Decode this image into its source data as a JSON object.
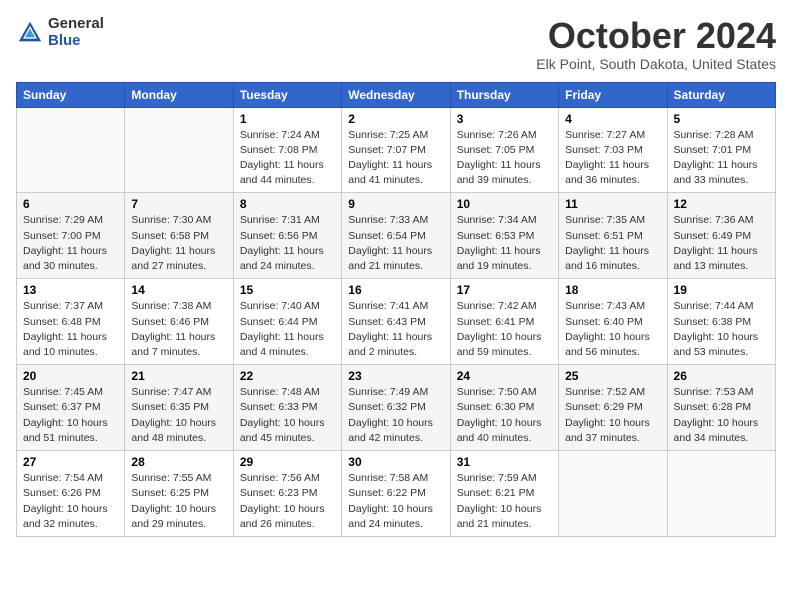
{
  "header": {
    "logo_general": "General",
    "logo_blue": "Blue",
    "title": "October 2024",
    "location": "Elk Point, South Dakota, United States"
  },
  "days_of_week": [
    "Sunday",
    "Monday",
    "Tuesday",
    "Wednesday",
    "Thursday",
    "Friday",
    "Saturday"
  ],
  "weeks": [
    [
      {
        "day": "",
        "content": ""
      },
      {
        "day": "",
        "content": ""
      },
      {
        "day": "1",
        "content": "Sunrise: 7:24 AM\nSunset: 7:08 PM\nDaylight: 11 hours and 44 minutes."
      },
      {
        "day": "2",
        "content": "Sunrise: 7:25 AM\nSunset: 7:07 PM\nDaylight: 11 hours and 41 minutes."
      },
      {
        "day": "3",
        "content": "Sunrise: 7:26 AM\nSunset: 7:05 PM\nDaylight: 11 hours and 39 minutes."
      },
      {
        "day": "4",
        "content": "Sunrise: 7:27 AM\nSunset: 7:03 PM\nDaylight: 11 hours and 36 minutes."
      },
      {
        "day": "5",
        "content": "Sunrise: 7:28 AM\nSunset: 7:01 PM\nDaylight: 11 hours and 33 minutes."
      }
    ],
    [
      {
        "day": "6",
        "content": "Sunrise: 7:29 AM\nSunset: 7:00 PM\nDaylight: 11 hours and 30 minutes."
      },
      {
        "day": "7",
        "content": "Sunrise: 7:30 AM\nSunset: 6:58 PM\nDaylight: 11 hours and 27 minutes."
      },
      {
        "day": "8",
        "content": "Sunrise: 7:31 AM\nSunset: 6:56 PM\nDaylight: 11 hours and 24 minutes."
      },
      {
        "day": "9",
        "content": "Sunrise: 7:33 AM\nSunset: 6:54 PM\nDaylight: 11 hours and 21 minutes."
      },
      {
        "day": "10",
        "content": "Sunrise: 7:34 AM\nSunset: 6:53 PM\nDaylight: 11 hours and 19 minutes."
      },
      {
        "day": "11",
        "content": "Sunrise: 7:35 AM\nSunset: 6:51 PM\nDaylight: 11 hours and 16 minutes."
      },
      {
        "day": "12",
        "content": "Sunrise: 7:36 AM\nSunset: 6:49 PM\nDaylight: 11 hours and 13 minutes."
      }
    ],
    [
      {
        "day": "13",
        "content": "Sunrise: 7:37 AM\nSunset: 6:48 PM\nDaylight: 11 hours and 10 minutes."
      },
      {
        "day": "14",
        "content": "Sunrise: 7:38 AM\nSunset: 6:46 PM\nDaylight: 11 hours and 7 minutes."
      },
      {
        "day": "15",
        "content": "Sunrise: 7:40 AM\nSunset: 6:44 PM\nDaylight: 11 hours and 4 minutes."
      },
      {
        "day": "16",
        "content": "Sunrise: 7:41 AM\nSunset: 6:43 PM\nDaylight: 11 hours and 2 minutes."
      },
      {
        "day": "17",
        "content": "Sunrise: 7:42 AM\nSunset: 6:41 PM\nDaylight: 10 hours and 59 minutes."
      },
      {
        "day": "18",
        "content": "Sunrise: 7:43 AM\nSunset: 6:40 PM\nDaylight: 10 hours and 56 minutes."
      },
      {
        "day": "19",
        "content": "Sunrise: 7:44 AM\nSunset: 6:38 PM\nDaylight: 10 hours and 53 minutes."
      }
    ],
    [
      {
        "day": "20",
        "content": "Sunrise: 7:45 AM\nSunset: 6:37 PM\nDaylight: 10 hours and 51 minutes."
      },
      {
        "day": "21",
        "content": "Sunrise: 7:47 AM\nSunset: 6:35 PM\nDaylight: 10 hours and 48 minutes."
      },
      {
        "day": "22",
        "content": "Sunrise: 7:48 AM\nSunset: 6:33 PM\nDaylight: 10 hours and 45 minutes."
      },
      {
        "day": "23",
        "content": "Sunrise: 7:49 AM\nSunset: 6:32 PM\nDaylight: 10 hours and 42 minutes."
      },
      {
        "day": "24",
        "content": "Sunrise: 7:50 AM\nSunset: 6:30 PM\nDaylight: 10 hours and 40 minutes."
      },
      {
        "day": "25",
        "content": "Sunrise: 7:52 AM\nSunset: 6:29 PM\nDaylight: 10 hours and 37 minutes."
      },
      {
        "day": "26",
        "content": "Sunrise: 7:53 AM\nSunset: 6:28 PM\nDaylight: 10 hours and 34 minutes."
      }
    ],
    [
      {
        "day": "27",
        "content": "Sunrise: 7:54 AM\nSunset: 6:26 PM\nDaylight: 10 hours and 32 minutes."
      },
      {
        "day": "28",
        "content": "Sunrise: 7:55 AM\nSunset: 6:25 PM\nDaylight: 10 hours and 29 minutes."
      },
      {
        "day": "29",
        "content": "Sunrise: 7:56 AM\nSunset: 6:23 PM\nDaylight: 10 hours and 26 minutes."
      },
      {
        "day": "30",
        "content": "Sunrise: 7:58 AM\nSunset: 6:22 PM\nDaylight: 10 hours and 24 minutes."
      },
      {
        "day": "31",
        "content": "Sunrise: 7:59 AM\nSunset: 6:21 PM\nDaylight: 10 hours and 21 minutes."
      },
      {
        "day": "",
        "content": ""
      },
      {
        "day": "",
        "content": ""
      }
    ]
  ]
}
